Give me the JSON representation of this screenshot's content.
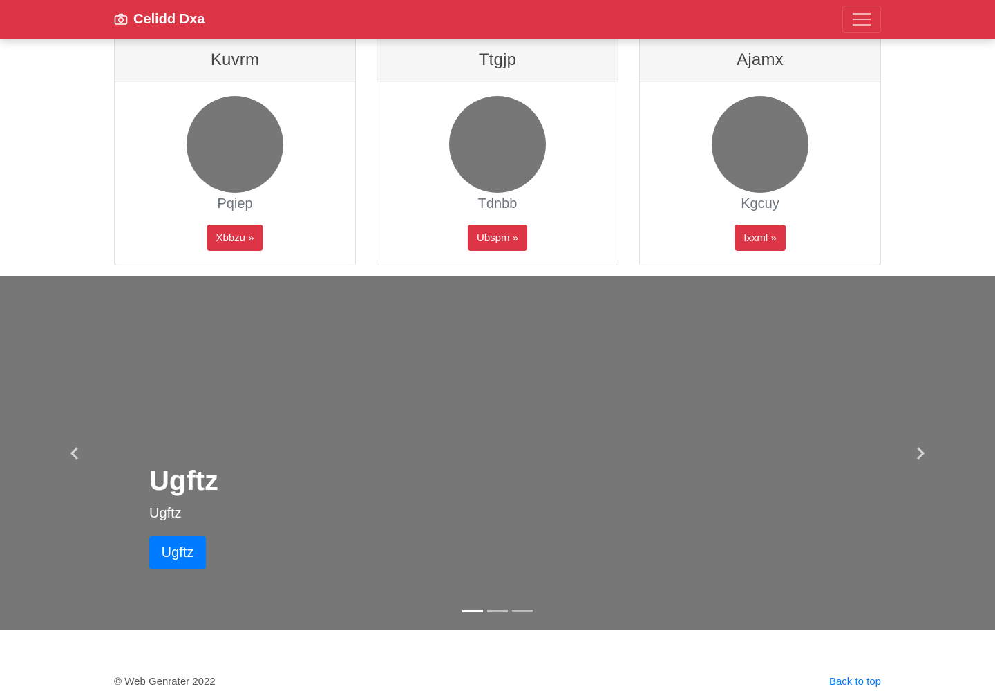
{
  "navbar": {
    "brand": "Celidd Dxa",
    "brand_icon": "camera-icon",
    "menu_icon": "hamburger-menu-icon",
    "color": "#dc3545"
  },
  "cards": [
    {
      "title": "Kuvrm",
      "subtitle": "Pqiep",
      "button": "Xbbzu »"
    },
    {
      "title": "Ttgjp",
      "subtitle": "Tdnbb",
      "button": "Ubspm »"
    },
    {
      "title": "Ajamx",
      "subtitle": "Kgcuy",
      "button": "Ixxml »"
    }
  ],
  "carousel": {
    "title": "Ugftz",
    "text": "Ugftz",
    "button": "Ugftz",
    "prev_icon": "chevron-left-icon",
    "next_icon": "chevron-right-icon",
    "indicator_count": 3,
    "active_indicator": 1,
    "background": "#777777"
  },
  "footer": {
    "copyright": "© Web Genrater 2022",
    "back_to_top": "Back to top"
  }
}
